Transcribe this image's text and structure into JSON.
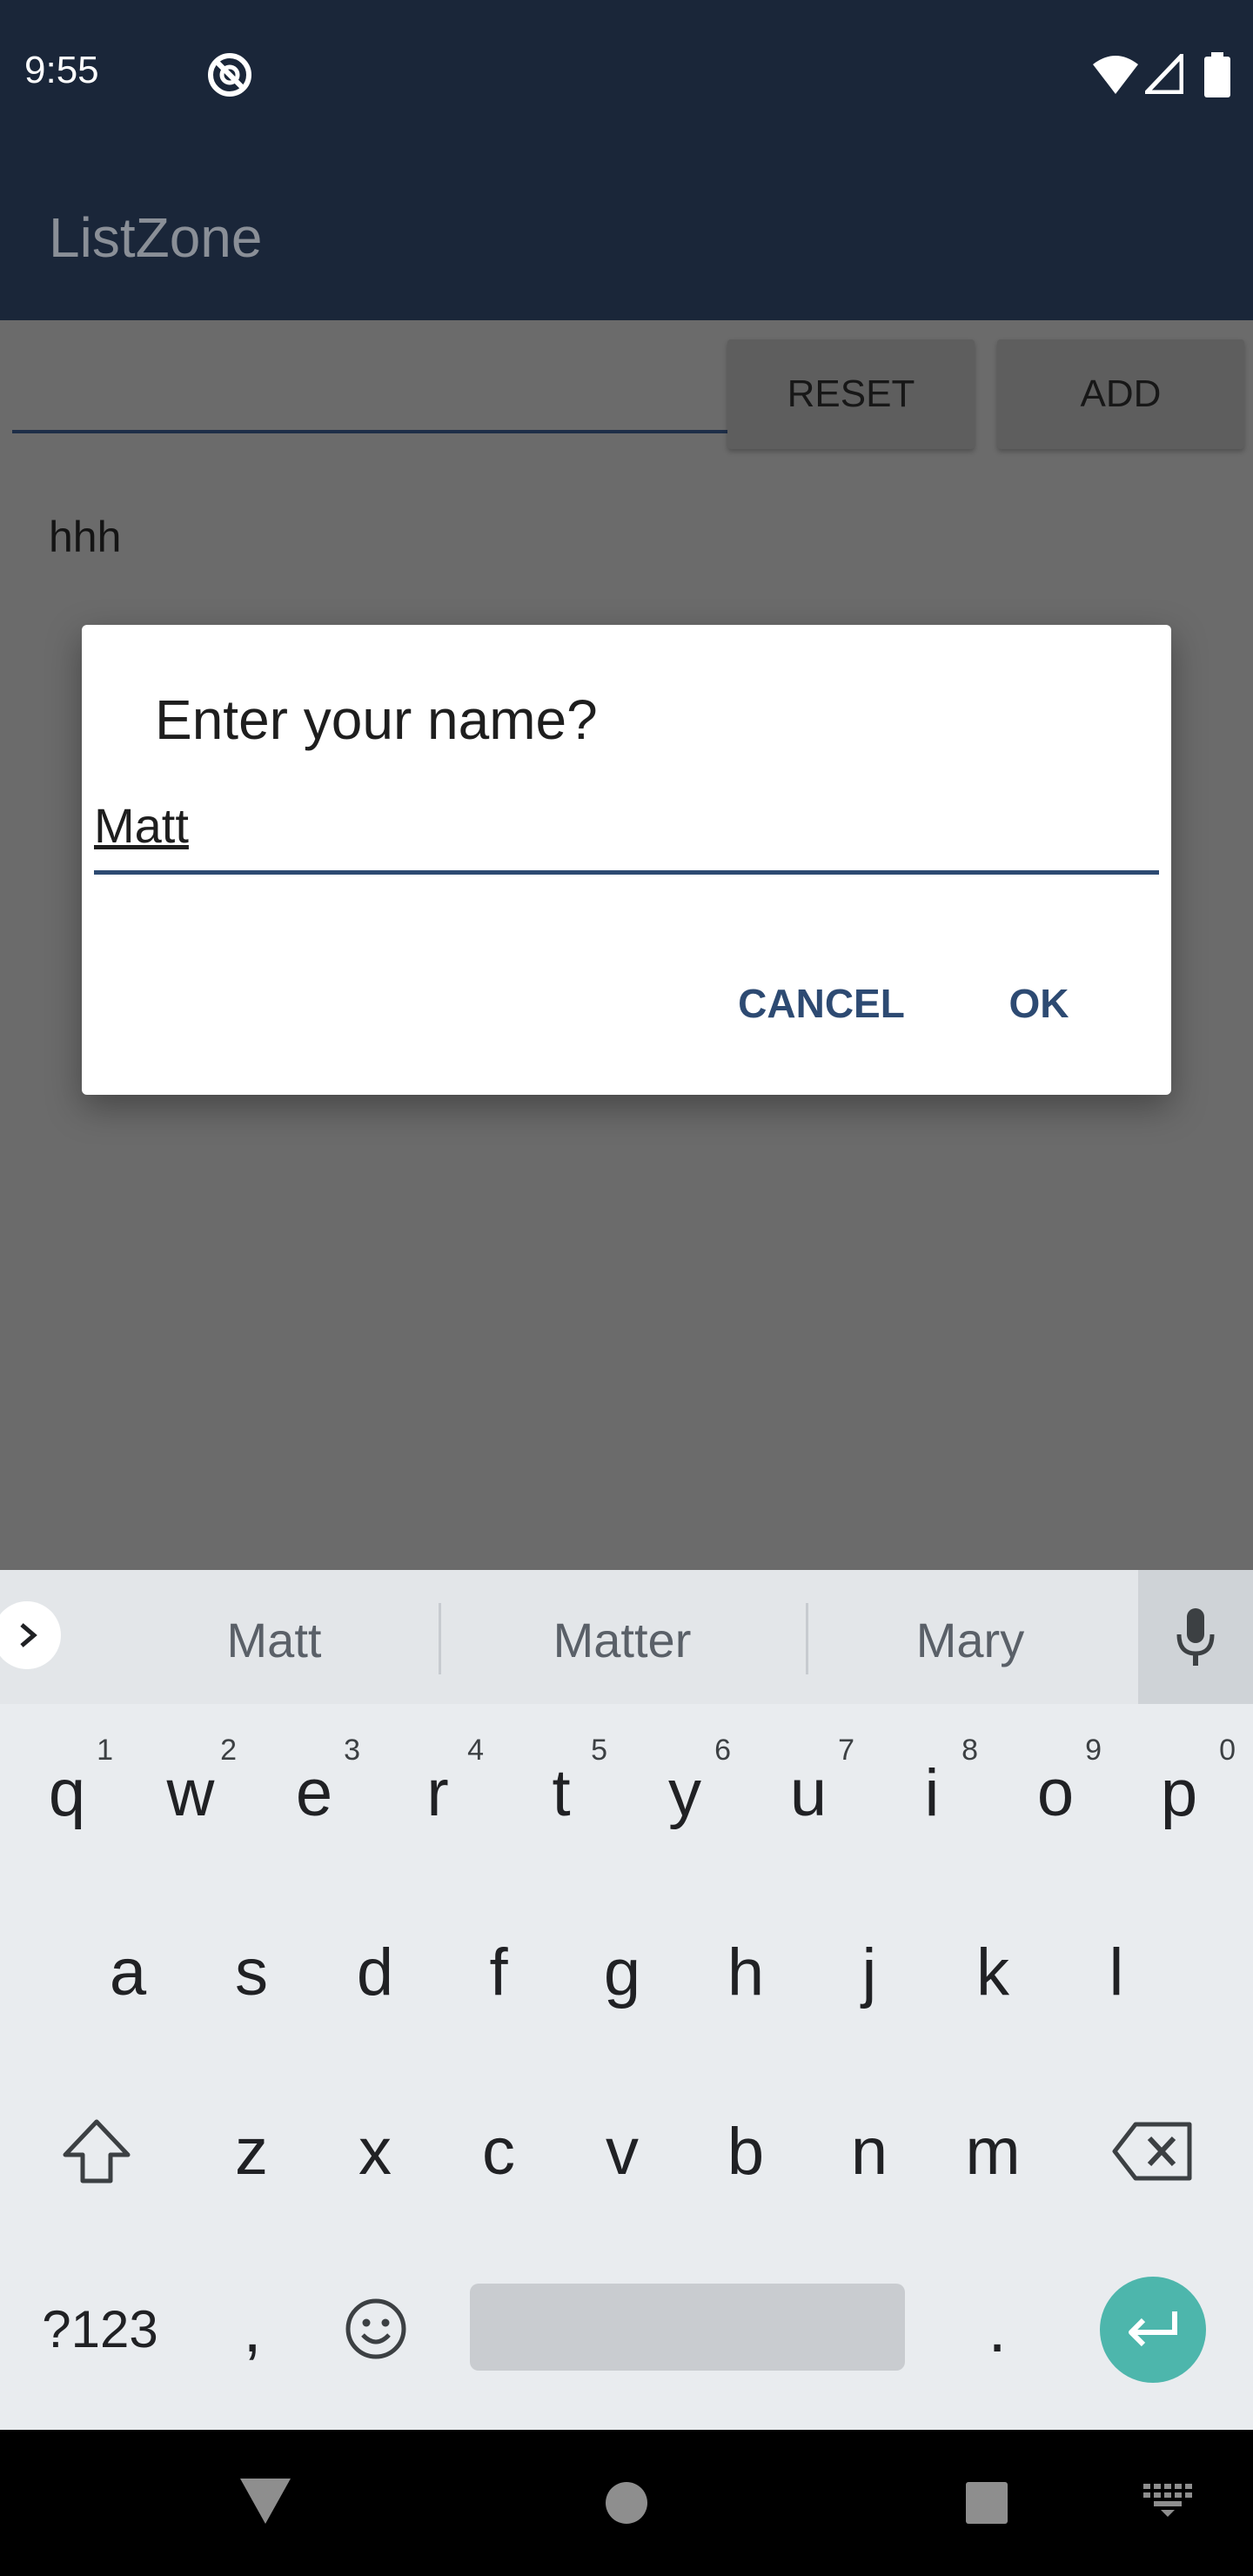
{
  "status_bar": {
    "time": "9:55",
    "icons": [
      "do-not-disturb-icon",
      "wifi-icon",
      "signal-icon",
      "battery-icon"
    ]
  },
  "app_bar": {
    "title": "ListZone"
  },
  "main": {
    "input_value": "",
    "reset_label": "RESET",
    "add_label": "ADD",
    "list_items": [
      "hhh"
    ]
  },
  "dialog": {
    "title": "Enter your name?",
    "input_value": "Matt",
    "cancel_label": "CANCEL",
    "ok_label": "OK"
  },
  "keyboard": {
    "suggestions": [
      "Matt",
      "Matter",
      "Mary"
    ],
    "row1": [
      {
        "key": "q",
        "hint": "1"
      },
      {
        "key": "w",
        "hint": "2"
      },
      {
        "key": "e",
        "hint": "3"
      },
      {
        "key": "r",
        "hint": "4"
      },
      {
        "key": "t",
        "hint": "5"
      },
      {
        "key": "y",
        "hint": "6"
      },
      {
        "key": "u",
        "hint": "7"
      },
      {
        "key": "i",
        "hint": "8"
      },
      {
        "key": "o",
        "hint": "9"
      },
      {
        "key": "p",
        "hint": "0"
      }
    ],
    "row2": [
      "a",
      "s",
      "d",
      "f",
      "g",
      "h",
      "j",
      "k",
      "l"
    ],
    "row3": [
      "z",
      "x",
      "c",
      "v",
      "b",
      "n",
      "m"
    ],
    "symbols_label": "?123",
    "comma_label": ",",
    "period_label": "."
  },
  "colors": {
    "app_bar": "#1a2639",
    "accent": "#2d4a72",
    "enter_key": "#4db6ac"
  }
}
